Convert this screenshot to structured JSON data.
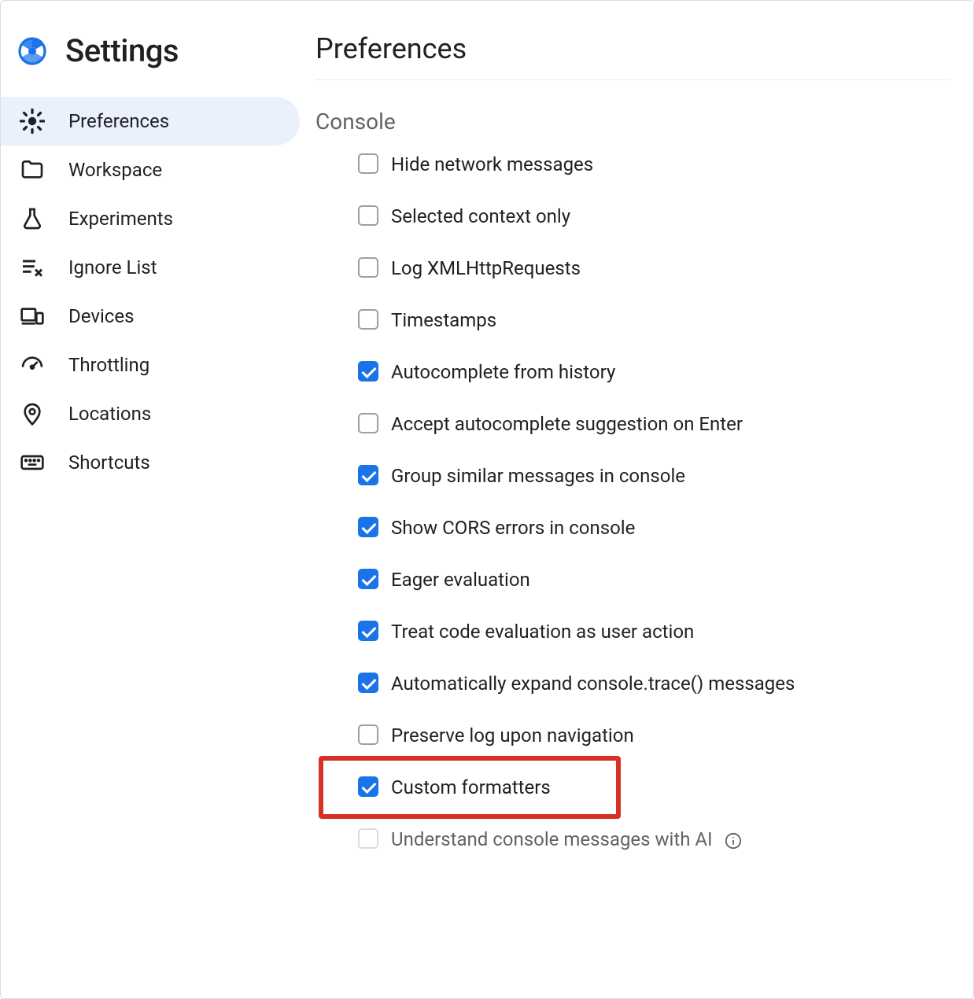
{
  "sidebar": {
    "title": "Settings",
    "items": [
      {
        "label": "Preferences",
        "icon": "gear-icon",
        "selected": true
      },
      {
        "label": "Workspace",
        "icon": "folder-icon",
        "selected": false
      },
      {
        "label": "Experiments",
        "icon": "flask-icon",
        "selected": false
      },
      {
        "label": "Ignore List",
        "icon": "list-remove-icon",
        "selected": false
      },
      {
        "label": "Devices",
        "icon": "devices-icon",
        "selected": false
      },
      {
        "label": "Throttling",
        "icon": "gauge-icon",
        "selected": false
      },
      {
        "label": "Locations",
        "icon": "location-pin-icon",
        "selected": false
      },
      {
        "label": "Shortcuts",
        "icon": "keyboard-icon",
        "selected": false
      }
    ]
  },
  "main": {
    "title": "Preferences",
    "section": {
      "title": "Console",
      "options": [
        {
          "label": "Hide network messages",
          "checked": false,
          "disabled": false,
          "info": false,
          "highlighted": false
        },
        {
          "label": "Selected context only",
          "checked": false,
          "disabled": false,
          "info": false,
          "highlighted": false
        },
        {
          "label": "Log XMLHttpRequests",
          "checked": false,
          "disabled": false,
          "info": false,
          "highlighted": false
        },
        {
          "label": "Timestamps",
          "checked": false,
          "disabled": false,
          "info": false,
          "highlighted": false
        },
        {
          "label": "Autocomplete from history",
          "checked": true,
          "disabled": false,
          "info": false,
          "highlighted": false
        },
        {
          "label": "Accept autocomplete suggestion on Enter",
          "checked": false,
          "disabled": false,
          "info": false,
          "highlighted": false
        },
        {
          "label": "Group similar messages in console",
          "checked": true,
          "disabled": false,
          "info": false,
          "highlighted": false
        },
        {
          "label": "Show CORS errors in console",
          "checked": true,
          "disabled": false,
          "info": false,
          "highlighted": false
        },
        {
          "label": "Eager evaluation",
          "checked": true,
          "disabled": false,
          "info": false,
          "highlighted": false
        },
        {
          "label": "Treat code evaluation as user action",
          "checked": true,
          "disabled": false,
          "info": false,
          "highlighted": false
        },
        {
          "label": "Automatically expand console.trace() messages",
          "checked": true,
          "disabled": false,
          "info": false,
          "highlighted": false
        },
        {
          "label": "Preserve log upon navigation",
          "checked": false,
          "disabled": false,
          "info": false,
          "highlighted": false
        },
        {
          "label": "Custom formatters",
          "checked": true,
          "disabled": false,
          "info": false,
          "highlighted": true
        },
        {
          "label": "Understand console messages with AI",
          "checked": false,
          "disabled": true,
          "info": true,
          "highlighted": false
        }
      ]
    }
  },
  "colors": {
    "accent": "#1a73e8",
    "highlight": "#d93025"
  }
}
